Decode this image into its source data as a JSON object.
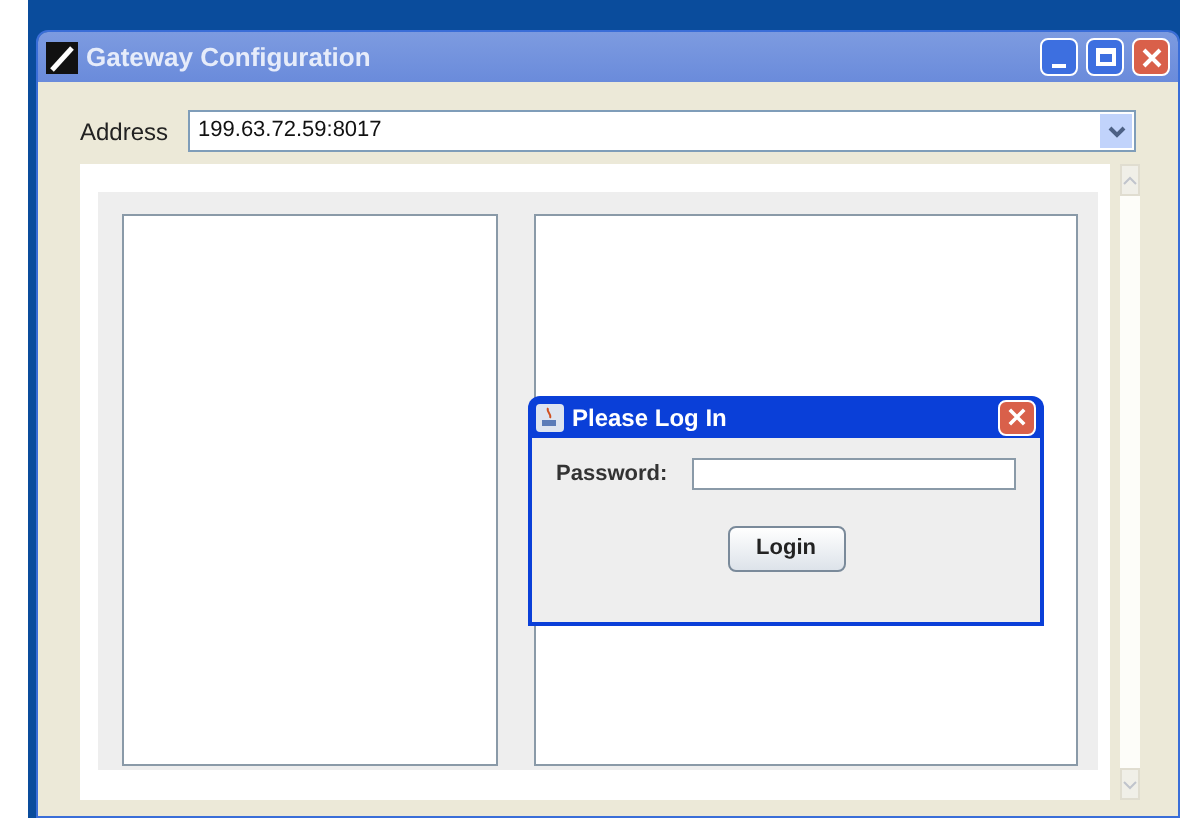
{
  "window": {
    "title": "Gateway Configuration"
  },
  "address": {
    "label": "Address",
    "value": "199.63.72.59:8017"
  },
  "dialog": {
    "title": "Please Log In",
    "password_label": "Password:",
    "button": "Login"
  }
}
